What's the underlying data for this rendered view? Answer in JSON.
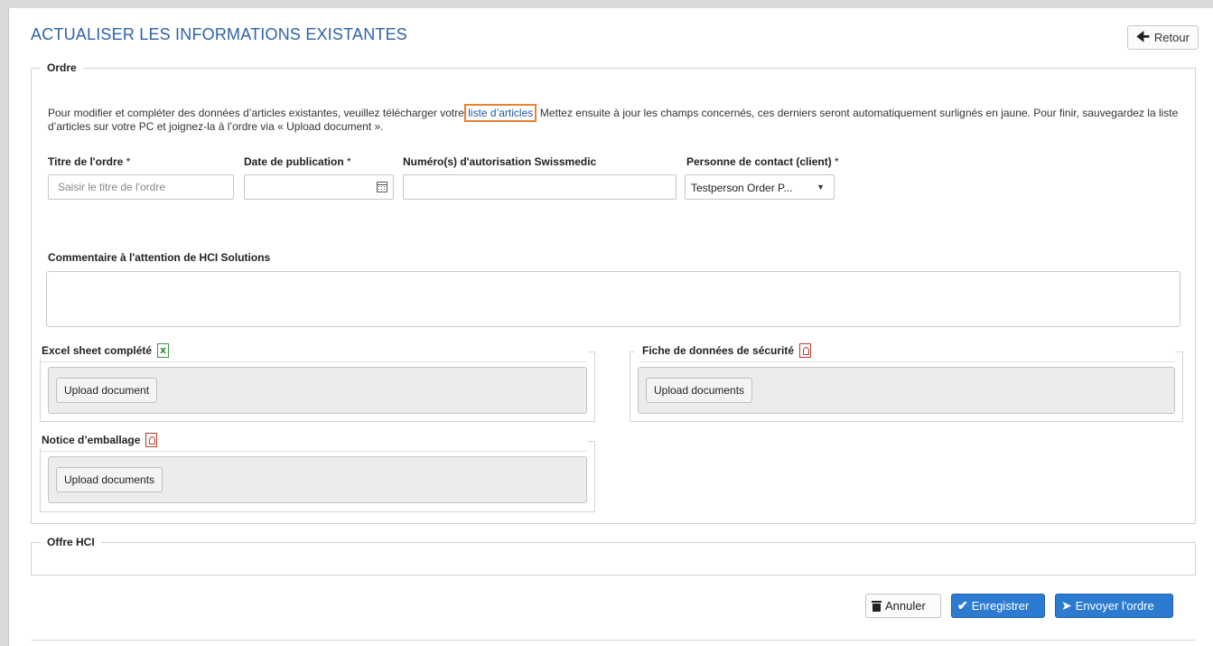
{
  "page": {
    "title": "ACTUALISER LES INFORMATIONS EXISTANTES",
    "back_label": "Retour"
  },
  "ordre": {
    "legend": "Ordre",
    "info_before": "Pour modifier et compléter des données d’articles existantes, veuillez télécharger votre ",
    "info_link": "liste d’articles",
    "info_after": ". Mettez ensuite à jour les champs concernés, ces derniers seront automatiquement surlignés en jaune. Pour finir, sauvegardez la liste d’articles sur votre PC et joignez-la à l’ordre via « Upload document ».",
    "fields": {
      "title_label": "Titre de l'ordre",
      "title_placeholder": "Saisir le titre de l'ordre",
      "title_value": "",
      "date_label": "Date de publication",
      "date_value": "",
      "auth_label": "Numéro(s) d'autorisation Swissmedic",
      "auth_value": "",
      "contact_label": "Personne de contact (client)",
      "contact_value": "Testperson Order P...",
      "required_mark": " *"
    },
    "comment_label": "Commentaire à l'attention de HCI Solutions",
    "comment_value": "",
    "uploads": [
      {
        "title": "Excel sheet complété",
        "icon": "excel-icon",
        "button": "Upload document"
      },
      {
        "title": "Fiche de données de sécurité",
        "icon": "pdf-icon",
        "button": "Upload documents"
      },
      {
        "title": "Notice d’emballage",
        "icon": "pdf-icon",
        "button": "Upload documents"
      }
    ]
  },
  "offre": {
    "legend": "Offre HCI"
  },
  "actions": {
    "cancel": "Annuler",
    "save": "Enregistrer",
    "send": "Envoyer l'ordre"
  },
  "colors": {
    "title": "#2f62a8",
    "primary_button": "#2d7bd0",
    "link_highlight": "#e8822e",
    "excel_icon": "#2e8b2e",
    "pdf_icon": "#c0392b"
  }
}
